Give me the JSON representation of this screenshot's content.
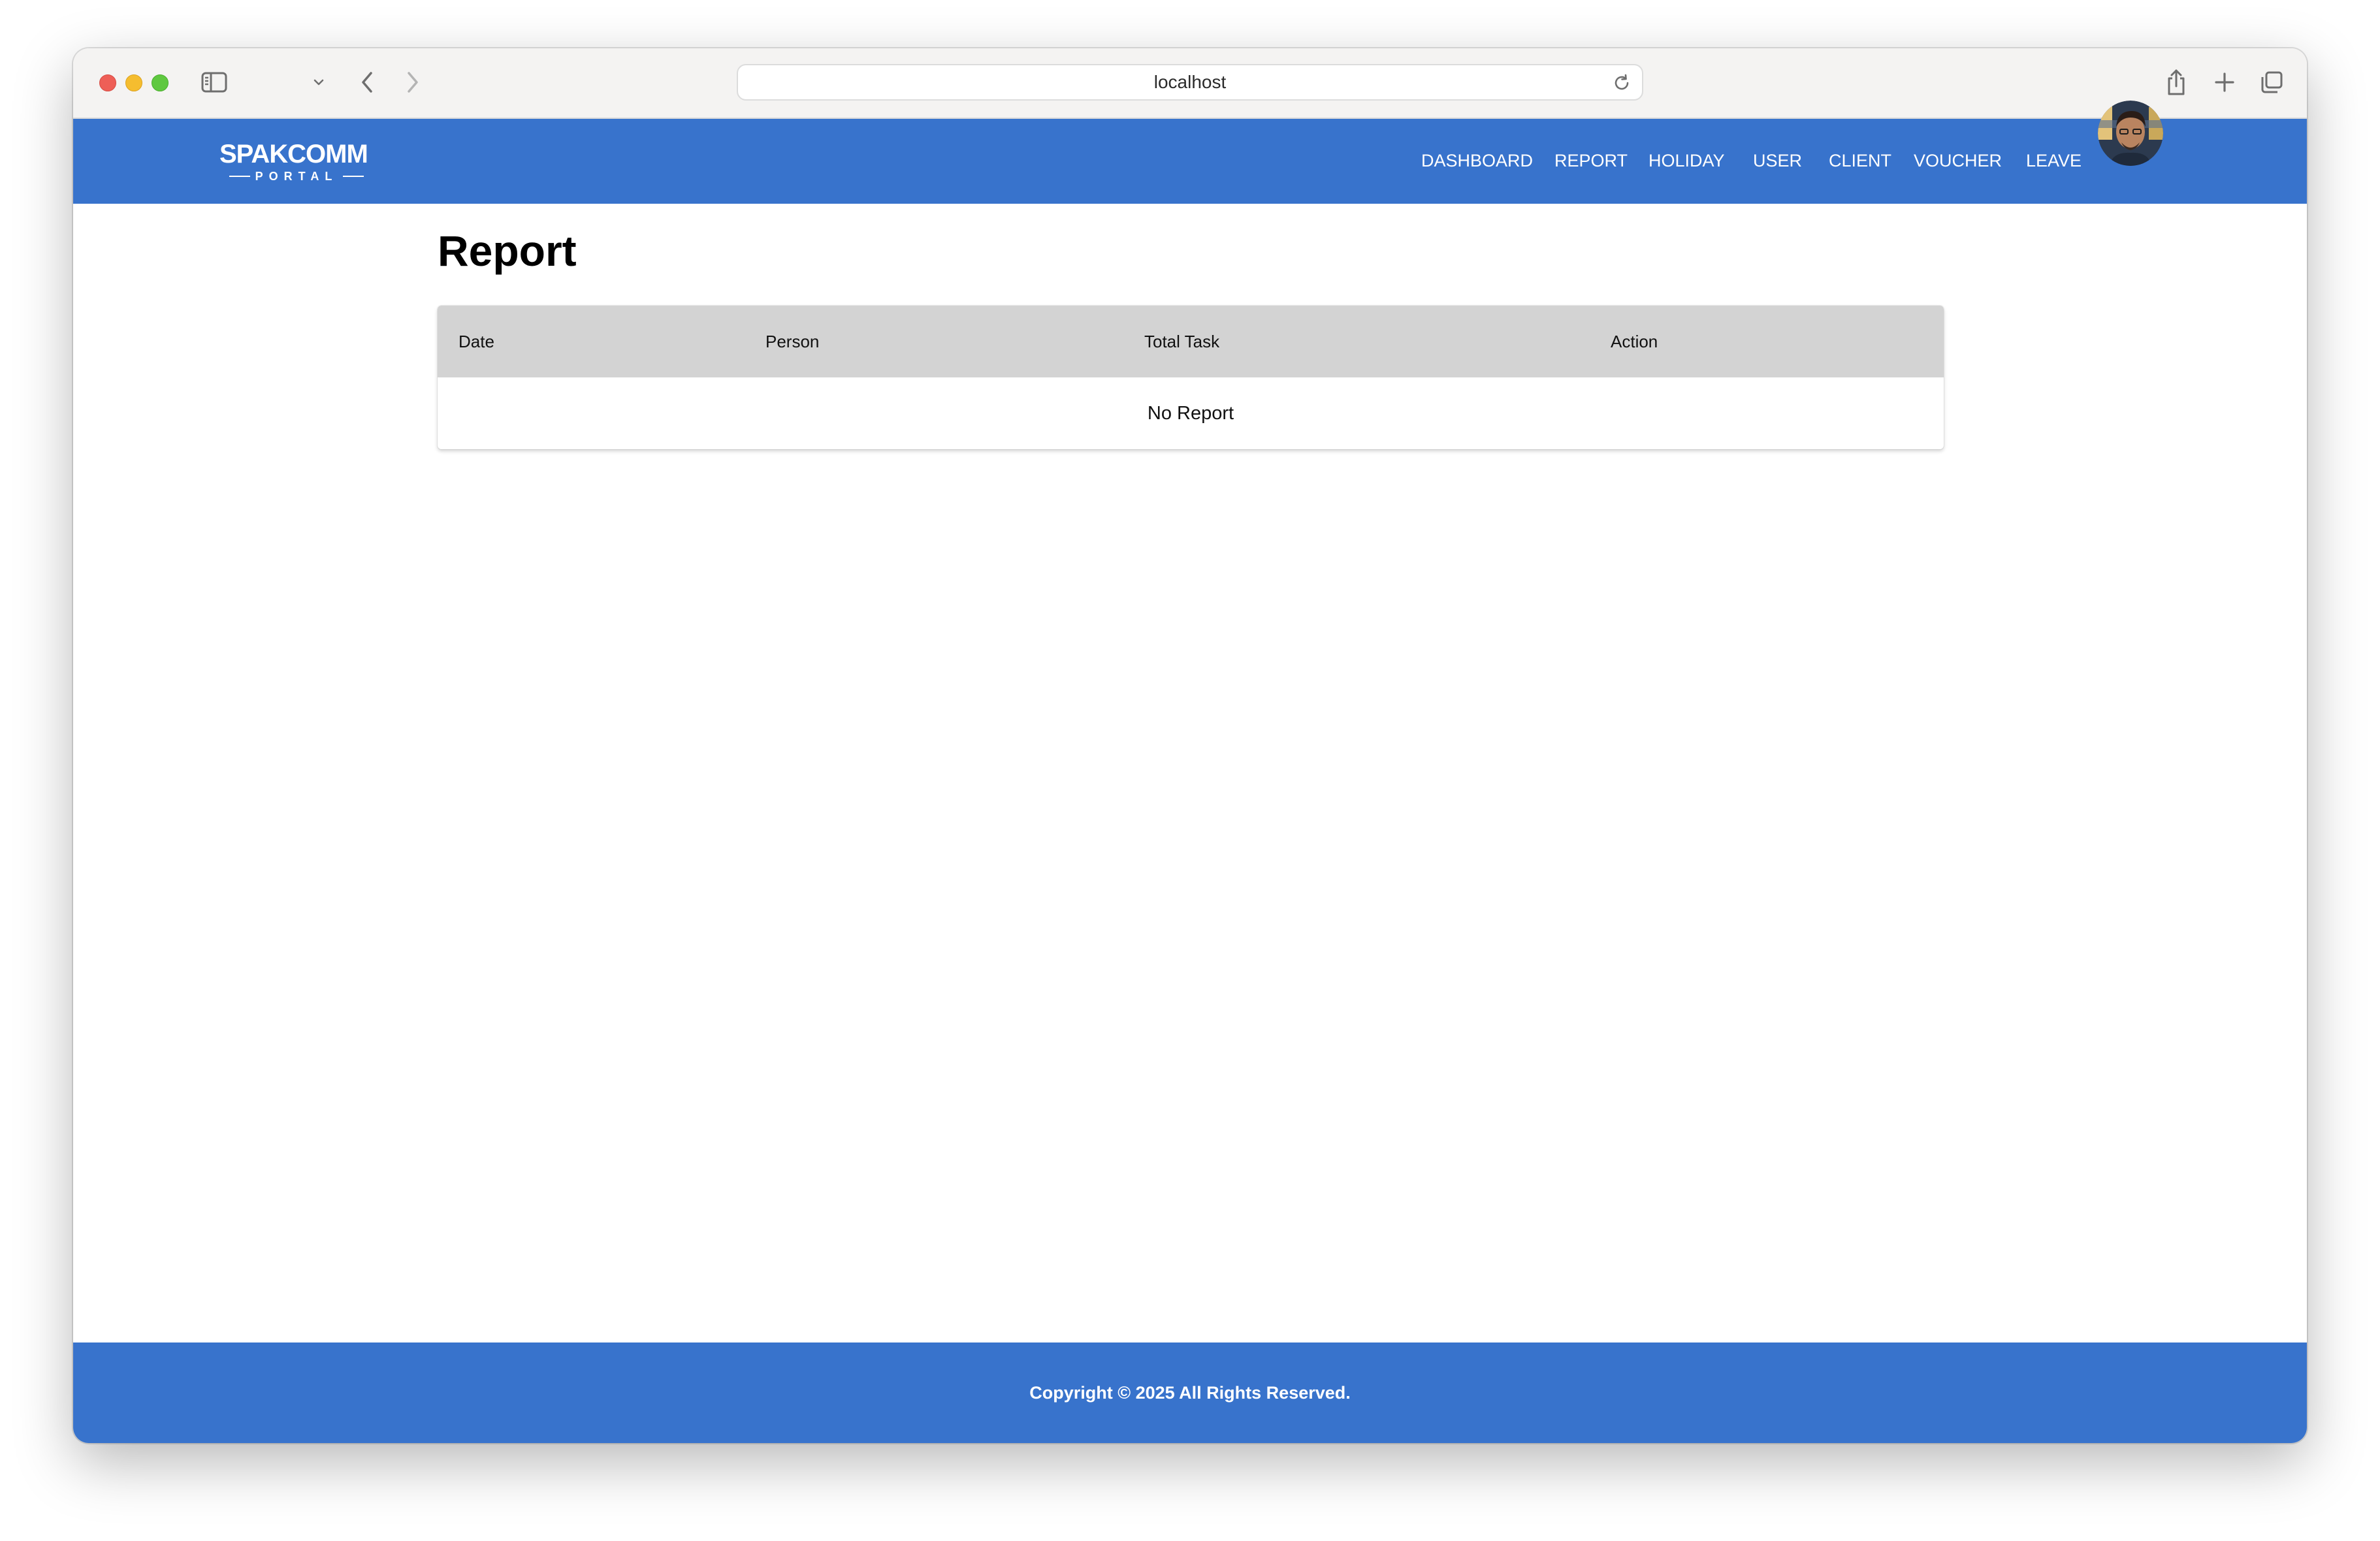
{
  "browser": {
    "address": "localhost"
  },
  "header": {
    "logo": {
      "main": "SPAKCOMM",
      "sub": "PORTAL"
    },
    "nav": [
      {
        "label": "DASHBOARD"
      },
      {
        "label": "REPORT"
      },
      {
        "label": "HOLIDAY"
      },
      {
        "label": "USER"
      },
      {
        "label": "CLIENT"
      },
      {
        "label": "VOUCHER"
      },
      {
        "label": "LEAVE"
      }
    ],
    "accent_color": "#3873cc"
  },
  "page": {
    "title": "Report"
  },
  "table": {
    "columns": [
      "Date",
      "Person",
      "Total Task",
      "Action"
    ],
    "empty_message": "No Report",
    "header_color": "#d3d3d3"
  },
  "footer": {
    "text": "Copyright © 2025 All Rights Reserved."
  }
}
